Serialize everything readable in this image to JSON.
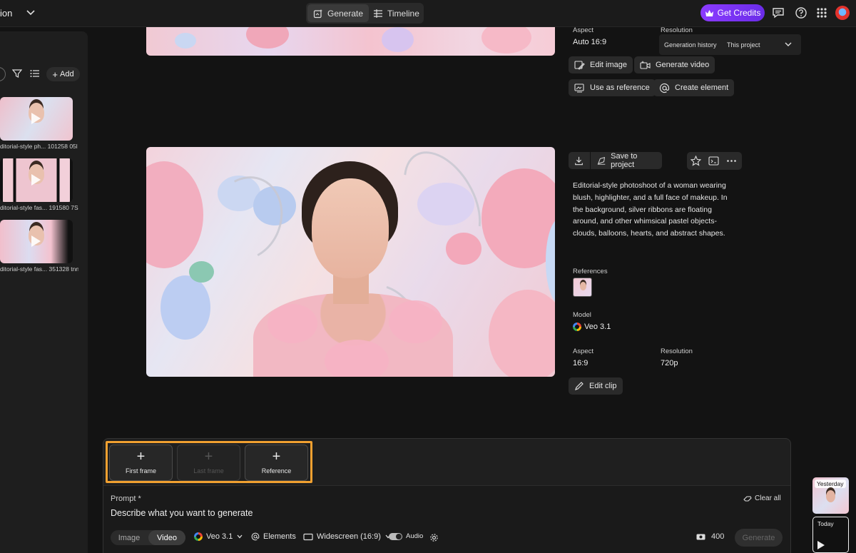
{
  "topbar": {
    "app_title_partial": "ion",
    "tabs": [
      {
        "label": "Generate",
        "icon": "generate-icon",
        "active": true
      },
      {
        "label": "Timeline",
        "icon": "timeline-icon",
        "active": false
      }
    ],
    "get_credits_label": "Get Credits",
    "accent_color": "#7b35f5"
  },
  "sidebar": {
    "add_label": "Add",
    "items": [
      {
        "caption": "ditorial-style ph... 101258 05l"
      },
      {
        "caption": "ditorial-style fas... 191580 7Sn"
      },
      {
        "caption": "ditorial-style fas... 351328 tnn"
      }
    ]
  },
  "previous_generation": {
    "aspect_label": "Aspect",
    "aspect_value": "Auto 16:9",
    "resolution_label": "Resolution",
    "generation_history_label": "Generation history",
    "generation_history_value": "This project",
    "actions": [
      "Edit image",
      "Generate video",
      "Use as reference",
      "Create element"
    ]
  },
  "current_generation": {
    "save_label": "Save to project",
    "description": "Editorial-style photoshoot of a woman wearing blush, highlighter, and a full face of makeup. In the background, silver ribbons are floating around, and other whimsical pastel objects- clouds, balloons, hearts, and abstract shapes.",
    "references_label": "References",
    "model_label": "Model",
    "model_value": "Veo 3.1",
    "aspect_label": "Aspect",
    "aspect_value": "16:9",
    "resolution_label": "Resolution",
    "resolution_value": "720p",
    "edit_clip_label": "Edit clip"
  },
  "composer": {
    "frames": [
      {
        "label": "First frame",
        "enabled": true
      },
      {
        "label": "Last frame",
        "enabled": false
      },
      {
        "label": "Reference",
        "enabled": true
      }
    ],
    "prompt_label": "Prompt *",
    "prompt_placeholder": "Describe what you want to generate",
    "clear_all_label": "Clear all",
    "modes": [
      "Image",
      "Video"
    ],
    "active_mode": "Video",
    "model": "Veo 3.1",
    "elements_label": "Elements",
    "aspect": "Widescreen (16:9)",
    "audio_label": "Audio",
    "credits": "400",
    "generate_label": "Generate",
    "highlight_color": "#f0a030"
  },
  "history_rail": {
    "cards": [
      {
        "label": "Yesterday"
      },
      {
        "label": "Today"
      }
    ]
  }
}
